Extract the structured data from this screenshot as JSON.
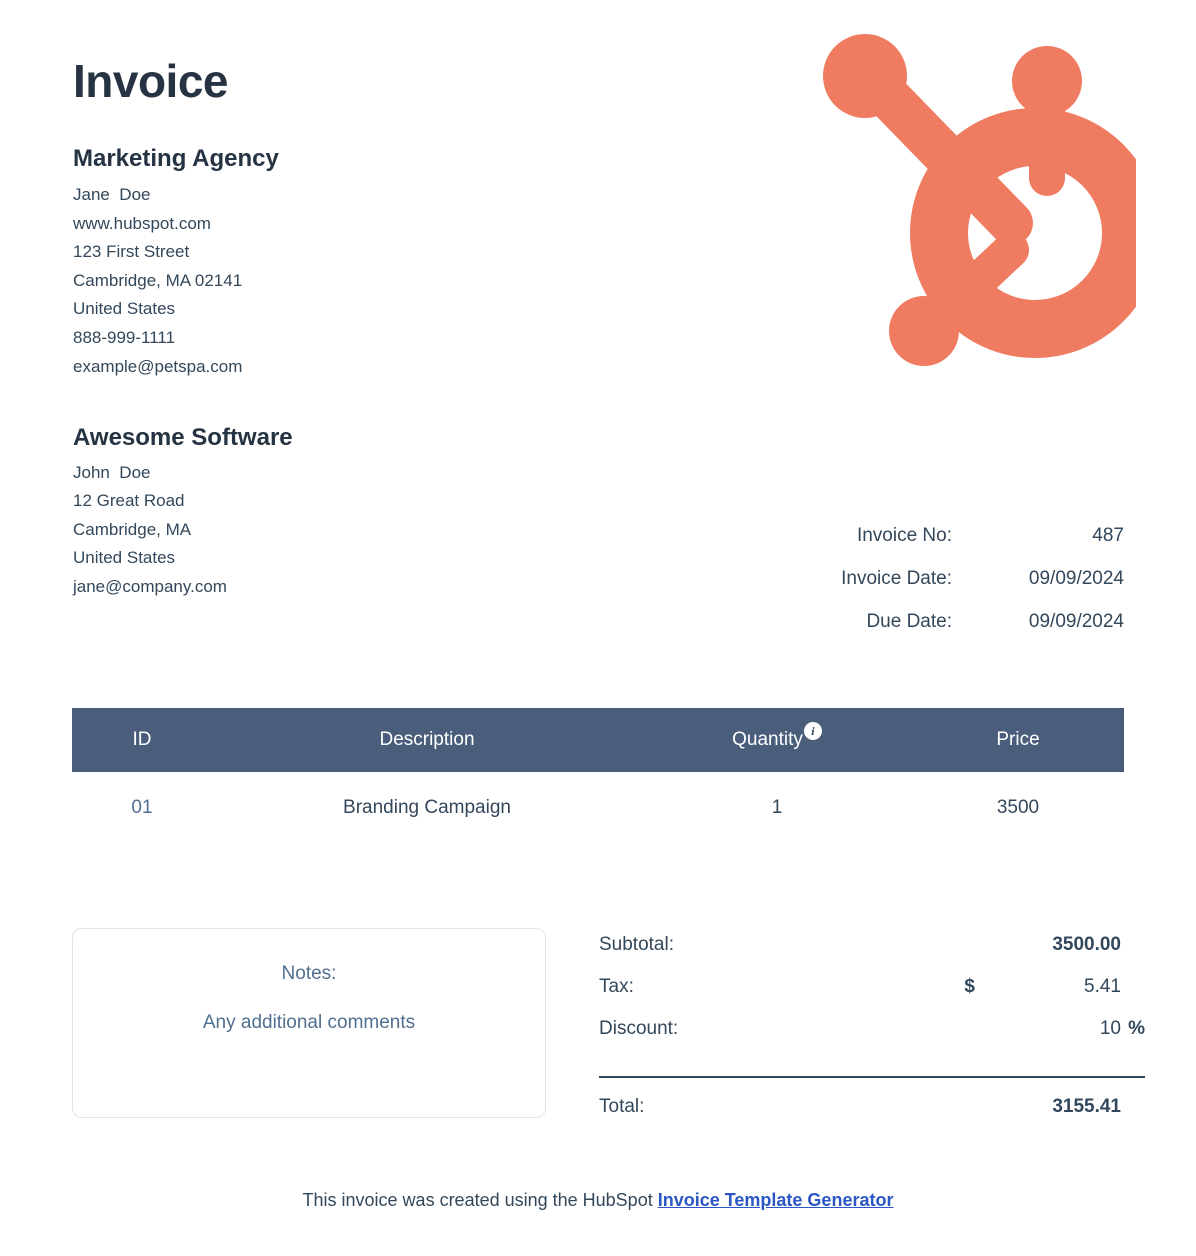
{
  "document": {
    "title": "Invoice"
  },
  "logo": {
    "icon_name": "hubspot-sprocket-logo",
    "color": "#ef7b61"
  },
  "sender": {
    "company": "Marketing Agency",
    "lines": [
      "Jane  Doe",
      "www.hubspot.com",
      "123 First Street",
      "Cambridge, MA 02141",
      "United States",
      "888-999-1111",
      "example@petspa.com"
    ]
  },
  "recipient": {
    "company": "Awesome Software",
    "lines": [
      "John  Doe",
      "12 Great Road",
      "Cambridge, MA",
      "United States",
      "jane@company.com"
    ]
  },
  "meta": {
    "rows": [
      {
        "label": "Invoice No:",
        "value": "487"
      },
      {
        "label": "Invoice Date:",
        "value": "09/09/2024"
      },
      {
        "label": "Due Date:",
        "value": "09/09/2024"
      }
    ]
  },
  "items_table": {
    "header_color": "#4a5e7c",
    "columns": {
      "id": "ID",
      "description": "Description",
      "quantity": "Quantity",
      "price": "Price"
    },
    "quantity_info_icon": "i",
    "rows": [
      {
        "id": "01",
        "description": "Branding Campaign",
        "quantity": "1",
        "price": "3500"
      }
    ]
  },
  "notes": {
    "label": "Notes:",
    "text": "Any additional comments"
  },
  "totals": {
    "subtotal": {
      "label": "Subtotal:",
      "symbol": "",
      "value": "3500.00",
      "suffix": ""
    },
    "tax": {
      "label": "Tax:",
      "symbol": "$",
      "value": "5.41",
      "suffix": ""
    },
    "discount": {
      "label": "Discount:",
      "symbol": "",
      "value": "10",
      "suffix": "%"
    },
    "total": {
      "label": "Total:",
      "value": "3155.41"
    }
  },
  "footer": {
    "text": "This invoice was created using the HubSpot ",
    "link": "Invoice Template Generator",
    "link_color": "#2b57c4"
  }
}
